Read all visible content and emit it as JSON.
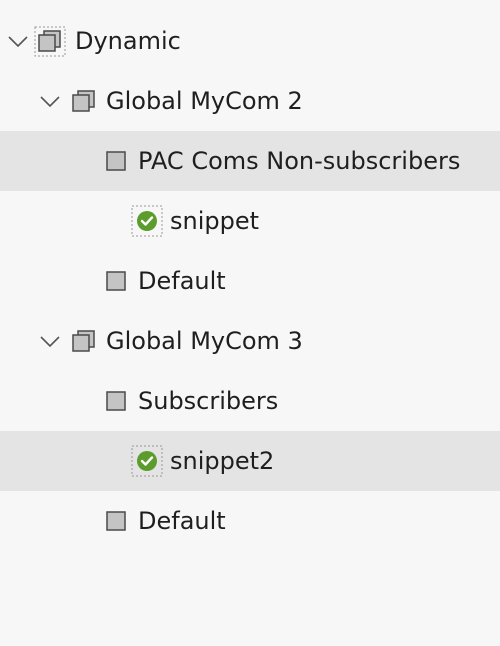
{
  "tree": {
    "nodes": [
      {
        "label": "Dynamic",
        "kind": "group",
        "expanded": true,
        "selected": false
      },
      {
        "label": "Global MyCom 2",
        "kind": "group",
        "expanded": true,
        "selected": false
      },
      {
        "label": "PAC Coms Non-subscribers",
        "kind": "segment",
        "selected": true
      },
      {
        "label": "snippet",
        "kind": "snippet",
        "status": "active",
        "selected": false
      },
      {
        "label": "Default",
        "kind": "segment",
        "selected": false
      },
      {
        "label": "Global MyCom 3",
        "kind": "group",
        "expanded": true,
        "selected": false
      },
      {
        "label": "Subscribers",
        "kind": "segment",
        "selected": false
      },
      {
        "label": "snippet2",
        "kind": "snippet",
        "status": "active",
        "selected": true
      },
      {
        "label": "Default",
        "kind": "segment",
        "selected": false
      }
    ]
  },
  "colors": {
    "background": "#f7f7f7",
    "selected_row": "#e4e4e4",
    "square_fill": "#c4c4c4",
    "square_border": "#4a4a4a",
    "check_green": "#5c9c2c"
  }
}
